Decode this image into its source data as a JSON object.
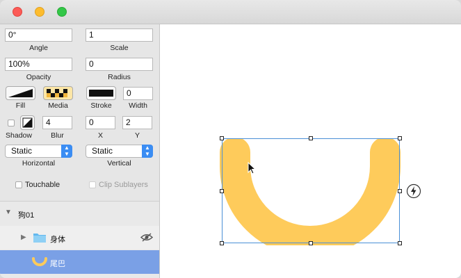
{
  "window": {
    "buttons": [
      "close",
      "minimize",
      "maximize"
    ]
  },
  "inspector": {
    "angle": {
      "label": "Angle",
      "value": "0°"
    },
    "scale": {
      "label": "Scale",
      "value": "1"
    },
    "opacity": {
      "label": "Opacity",
      "value": "100%"
    },
    "radius": {
      "label": "Radius",
      "value": "0"
    },
    "fill": {
      "label": "Fill"
    },
    "media": {
      "label": "Media"
    },
    "stroke": {
      "label": "Stroke"
    },
    "width": {
      "label": "Width",
      "value": "0"
    },
    "shadow": {
      "label": "Shadow"
    },
    "blur": {
      "label": "Blur",
      "value": "4"
    },
    "x": {
      "label": "X",
      "value": "0"
    },
    "y": {
      "label": "Y",
      "value": "2"
    },
    "horizontal": {
      "label": "Horizontal",
      "value": "Static"
    },
    "vertical": {
      "label": "Vertical",
      "value": "Static"
    },
    "touchable": {
      "label": "Touchable",
      "checked": false
    },
    "clip_sublayers": {
      "label": "Clip Sublayers",
      "checked": false,
      "disabled": true
    }
  },
  "layers": {
    "items": [
      {
        "name": "狗01",
        "icon": "disclosure-down-icon"
      },
      {
        "name": "身体",
        "icon": "folder-icon",
        "visibility_icon": "eye-icon"
      },
      {
        "name": "尾巴",
        "icon": "tail-arc-icon",
        "selected": true
      }
    ]
  },
  "canvas": {
    "shape_color": "#fecb5b",
    "selection_color": "#4a8fd6",
    "lightning_icon": "lightning-icon"
  }
}
